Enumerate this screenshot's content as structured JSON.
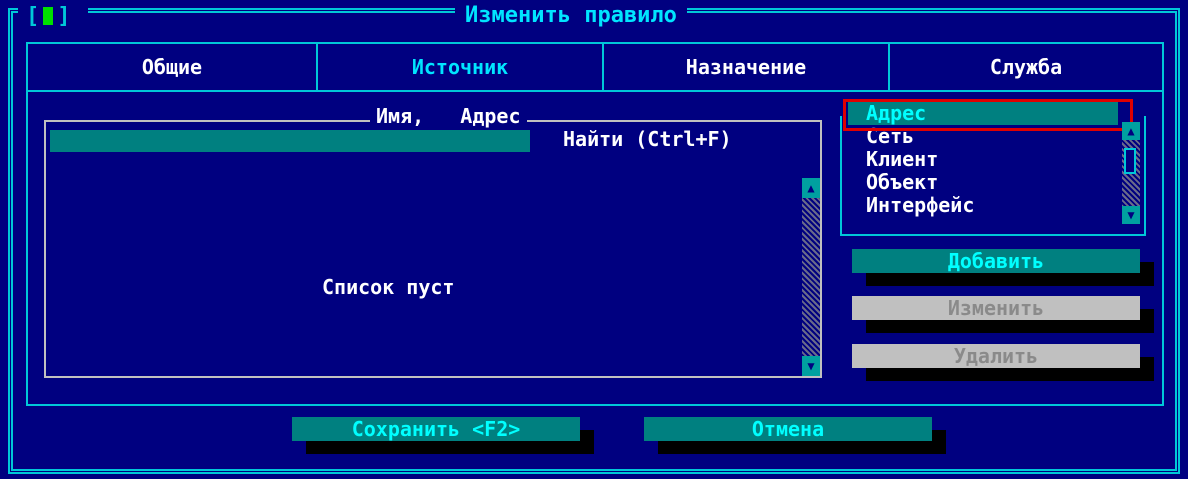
{
  "window": {
    "title": "Изменить правило",
    "close_box": "[",
    "close_box_end": "]"
  },
  "tabs": [
    {
      "label": "Общие",
      "active": false
    },
    {
      "label": "Источник",
      "active": true
    },
    {
      "label": "Назначение",
      "active": false
    },
    {
      "label": "Служба",
      "active": false
    }
  ],
  "list": {
    "columns": "Имя,   Адрес",
    "find_label": "Найти (Ctrl+F)",
    "empty_text": "Список пуст",
    "scroll_up": "▲",
    "scroll_down": "▼"
  },
  "fields": {
    "items": [
      "Адрес",
      "Сеть",
      "Клиент",
      "Объект",
      "Интерфейс"
    ],
    "selected": "Адрес"
  },
  "buttons": {
    "add": "Добавить",
    "edit": "Изменить",
    "delete": "Удалить",
    "save": "Сохранить <F2>",
    "cancel": "Отмена"
  },
  "colors": {
    "background": "#000080",
    "frame": "#00c8d8",
    "selection": "#008080",
    "highlight_outline": "#e00000"
  }
}
